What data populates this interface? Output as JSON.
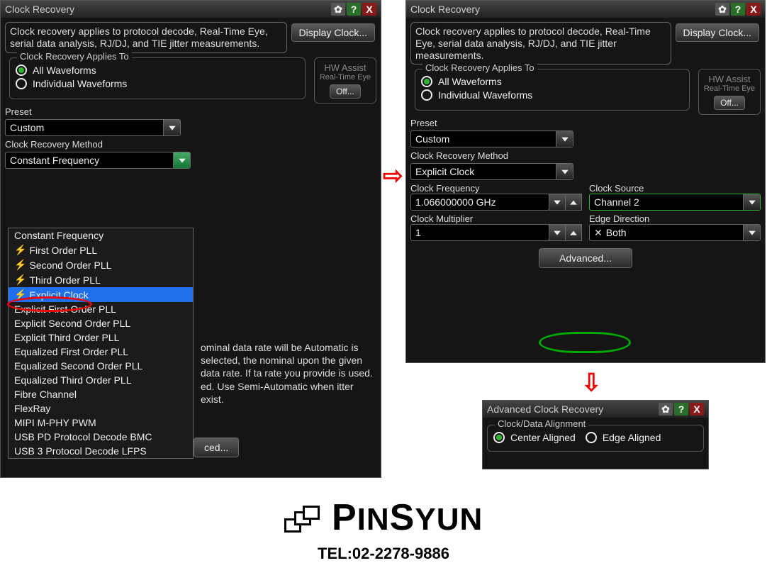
{
  "panel1": {
    "title": "Clock Recovery",
    "desc": "Clock recovery applies to protocol decode, Real-Time Eye, serial data analysis, RJ/DJ, and TIE jitter measurements.",
    "display_clock_btn": "Display Clock...",
    "applies_to_legend": "Clock Recovery Applies To",
    "radio_all": "All Waveforms",
    "radio_individual": "Individual Waveforms",
    "hw_assist_title": "HW Assist",
    "hw_assist_sub": "Real-Time Eye",
    "hw_assist_btn": "Off...",
    "preset_label": "Preset",
    "preset_value": "Custom",
    "method_label": "Clock Recovery Method",
    "method_value": "Constant Frequency",
    "dropdown_options": [
      {
        "label": "Constant Frequency",
        "bolt": false
      },
      {
        "label": "First Order PLL",
        "bolt": true
      },
      {
        "label": "Second Order PLL",
        "bolt": true
      },
      {
        "label": "Third Order PLL",
        "bolt": true
      },
      {
        "label": "Explicit Clock",
        "bolt": true,
        "selected": true
      },
      {
        "label": "Explicit First Order PLL",
        "bolt": false
      },
      {
        "label": "Explicit Second Order PLL",
        "bolt": false
      },
      {
        "label": "Explicit Third Order PLL",
        "bolt": false
      },
      {
        "label": "Equalized First Order PLL",
        "bolt": false
      },
      {
        "label": "Equalized Second Order PLL",
        "bolt": false
      },
      {
        "label": "Equalized Third Order PLL",
        "bolt": false
      },
      {
        "label": "Fibre Channel",
        "bolt": false
      },
      {
        "label": "FlexRay",
        "bolt": false
      },
      {
        "label": "MIPI M-PHY PWM",
        "bolt": false
      },
      {
        "label": "USB PD Protocol Decode BMC",
        "bolt": false
      },
      {
        "label": "USB 3 Protocol Decode LFPS",
        "bolt": false
      }
    ],
    "body_text_right": "ominal data rate will be Automatic is selected, the nominal upon the given data rate. If ta rate you provide is used.\ned. Use Semi-Automatic when itter exist.",
    "advanced_partial": "ced..."
  },
  "panel2": {
    "title": "Clock Recovery",
    "desc": "Clock recovery applies to protocol decode, Real-Time Eye, serial data analysis, RJ/DJ, and TIE jitter measurements.",
    "display_clock_btn": "Display Clock...",
    "applies_to_legend": "Clock Recovery Applies To",
    "radio_all": "All Waveforms",
    "radio_individual": "Individual Waveforms",
    "hw_assist_title": "HW Assist",
    "hw_assist_sub": "Real-Time Eye",
    "hw_assist_btn": "Off...",
    "preset_label": "Preset",
    "preset_value": "Custom",
    "method_label": "Clock Recovery Method",
    "method_value": "Explicit Clock",
    "clock_freq_label": "Clock Frequency",
    "clock_freq_value": "1.066000000 GHz",
    "clock_source_label": "Clock Source",
    "clock_source_value": "Channel 2",
    "clock_mult_label": "Clock Multiplier",
    "clock_mult_value": "1",
    "edge_dir_label": "Edge Direction",
    "edge_dir_value": "Both",
    "advanced_btn": "Advanced..."
  },
  "panel3": {
    "title": "Advanced Clock Recovery",
    "legend": "Clock/Data Alignment",
    "radio_center": "Center Aligned",
    "radio_edge": "Edge Aligned"
  },
  "footer": {
    "brand_p": "P",
    "brand_in": "IN",
    "brand_s": "S",
    "brand_yun": "YUN",
    "tel": "TEL:02-2278-9886"
  }
}
